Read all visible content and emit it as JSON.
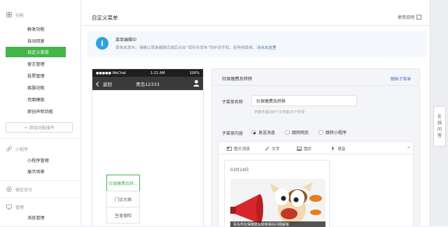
{
  "sidebar": {
    "sections": [
      {
        "label": "功能",
        "icon": "feature-icon",
        "items": [
          "群发功能",
          "自动回复",
          "自定义菜单",
          "留言管理",
          "投票管理",
          "客服功能",
          "页面模板",
          "原创声明功能"
        ]
      },
      {
        "label": "小程序",
        "icon": "mini-program-icon",
        "items": [
          "小程序管理",
          "展示场景"
        ]
      },
      {
        "label": "微信支付",
        "icon": "wechat-pay-icon",
        "items": []
      },
      {
        "label": "管理",
        "icon": "manage-icon",
        "items": [
          "消息管理"
        ]
      }
    ],
    "active_item": "自定义菜单",
    "add_plugin_label": "+ 添加功能插件"
  },
  "header": {
    "title": "自定义菜单",
    "help_label": "使用说明"
  },
  "notice": {
    "title": "菜单编辑中",
    "text": "菜单未发布，请确认菜单编辑完成后点击“保存并发布”同步到手机。若停用菜单，请",
    "link": "点击这里"
  },
  "phone": {
    "carrier": "●●●●● WeChat",
    "time": "1:21 AM",
    "battery": "100%",
    "back_label": "返回",
    "account_name": "青岛12333",
    "submenu": [
      "社保缴费及转移",
      "门诊大病",
      "生育保险"
    ],
    "selected_submenu": "社保缴费及转..."
  },
  "config": {
    "menu_name": "社保缴费及转移",
    "delete_label": "删除子菜单",
    "name_label": "子菜单名称",
    "name_value": "社保缴费及转移",
    "name_hint": "字数不超过8个汉字或16个字母",
    "content_label": "子菜单内容",
    "content_options": [
      "发送消息",
      "跳转网页",
      "跳转小程序"
    ],
    "content_selected": "发送消息",
    "editor_tabs": [
      "图文消息",
      "文字",
      "图片",
      "语音"
    ],
    "card_date": "03月14日",
    "card_caption": "青岛市社保缴费及转移相关问题解答"
  },
  "right_tab": {
    "chars": [
      "在",
      "线",
      "问",
      "答"
    ]
  },
  "colors": {
    "green": "#44b549",
    "blue": "#2f9fe8",
    "link": "#3a6fb0"
  }
}
